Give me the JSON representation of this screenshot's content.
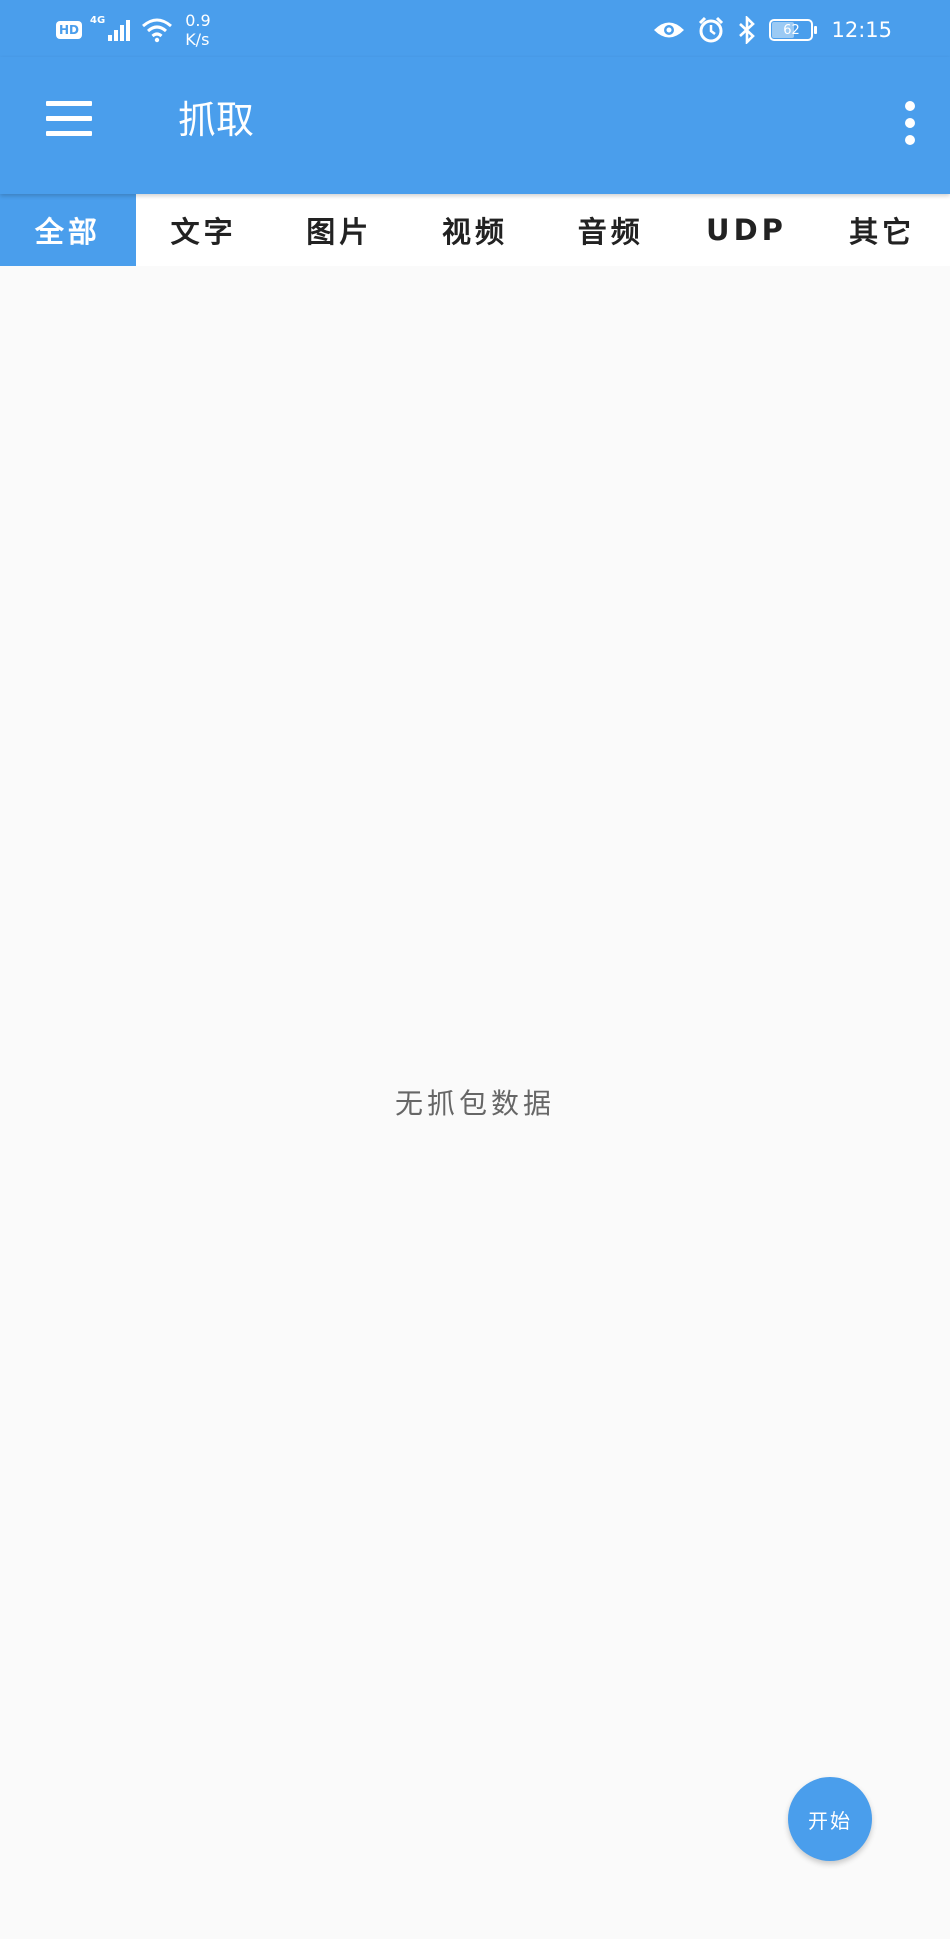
{
  "status_bar": {
    "hd_badge": "HD",
    "network_type": "4G",
    "net_speed_value": "0.9",
    "net_speed_unit": "K/s",
    "battery_level": "62",
    "battery_fraction": 0.62,
    "time": "12:15",
    "icons": [
      "signal-icon",
      "wifi-icon",
      "eye-icon",
      "alarm-icon",
      "bluetooth-icon",
      "battery-icon"
    ]
  },
  "app_bar": {
    "title": "抓取",
    "menu_icon": "hamburger-menu-icon",
    "overflow_icon": "more-vertical-icon"
  },
  "tabs": [
    {
      "label": "全部",
      "active": true
    },
    {
      "label": "文字",
      "active": false
    },
    {
      "label": "图片",
      "active": false
    },
    {
      "label": "视频",
      "active": false
    },
    {
      "label": "音频",
      "active": false
    },
    {
      "label": "UDP",
      "active": false
    },
    {
      "label": "其它",
      "active": false
    }
  ],
  "main": {
    "empty_text": "无抓包数据"
  },
  "fab": {
    "label": "开始"
  },
  "colors": {
    "primary": "#4a9eec",
    "background": "#fafafa",
    "tab_background": "#ffffff",
    "text_dark": "#222222",
    "text_muted": "#666666"
  }
}
